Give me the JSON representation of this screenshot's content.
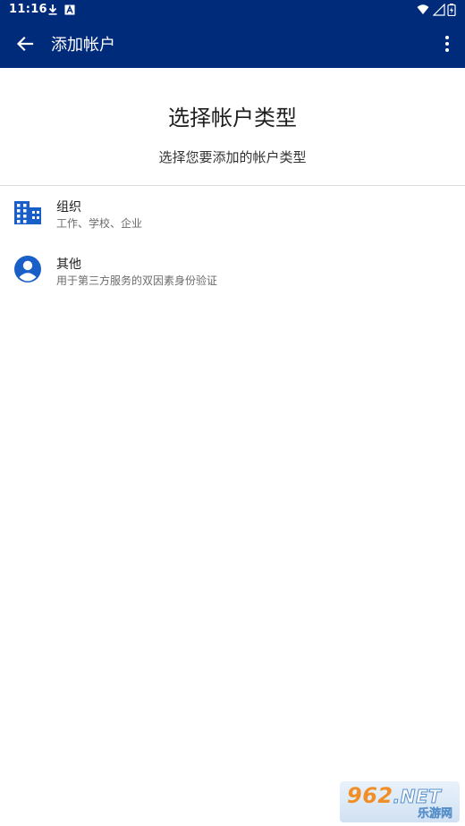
{
  "status_bar": {
    "time": "11:16"
  },
  "app_bar": {
    "title": "添加帐户"
  },
  "header": {
    "title": "选择帐户类型",
    "subtitle": "选择您要添加的帐户类型"
  },
  "account_types": [
    {
      "title": "组织",
      "description": "工作、学校、企业",
      "icon": "building-icon"
    },
    {
      "title": "其他",
      "description": "用于第三方服务的双因素身份验证",
      "icon": "person-icon"
    }
  ],
  "watermark": {
    "brand": "962",
    "suffix": ".NET",
    "tagline": "乐游网"
  },
  "colors": {
    "app_bar": "#002a7a",
    "icon_blue": "#1a5fc8",
    "background": "#ffffff"
  }
}
